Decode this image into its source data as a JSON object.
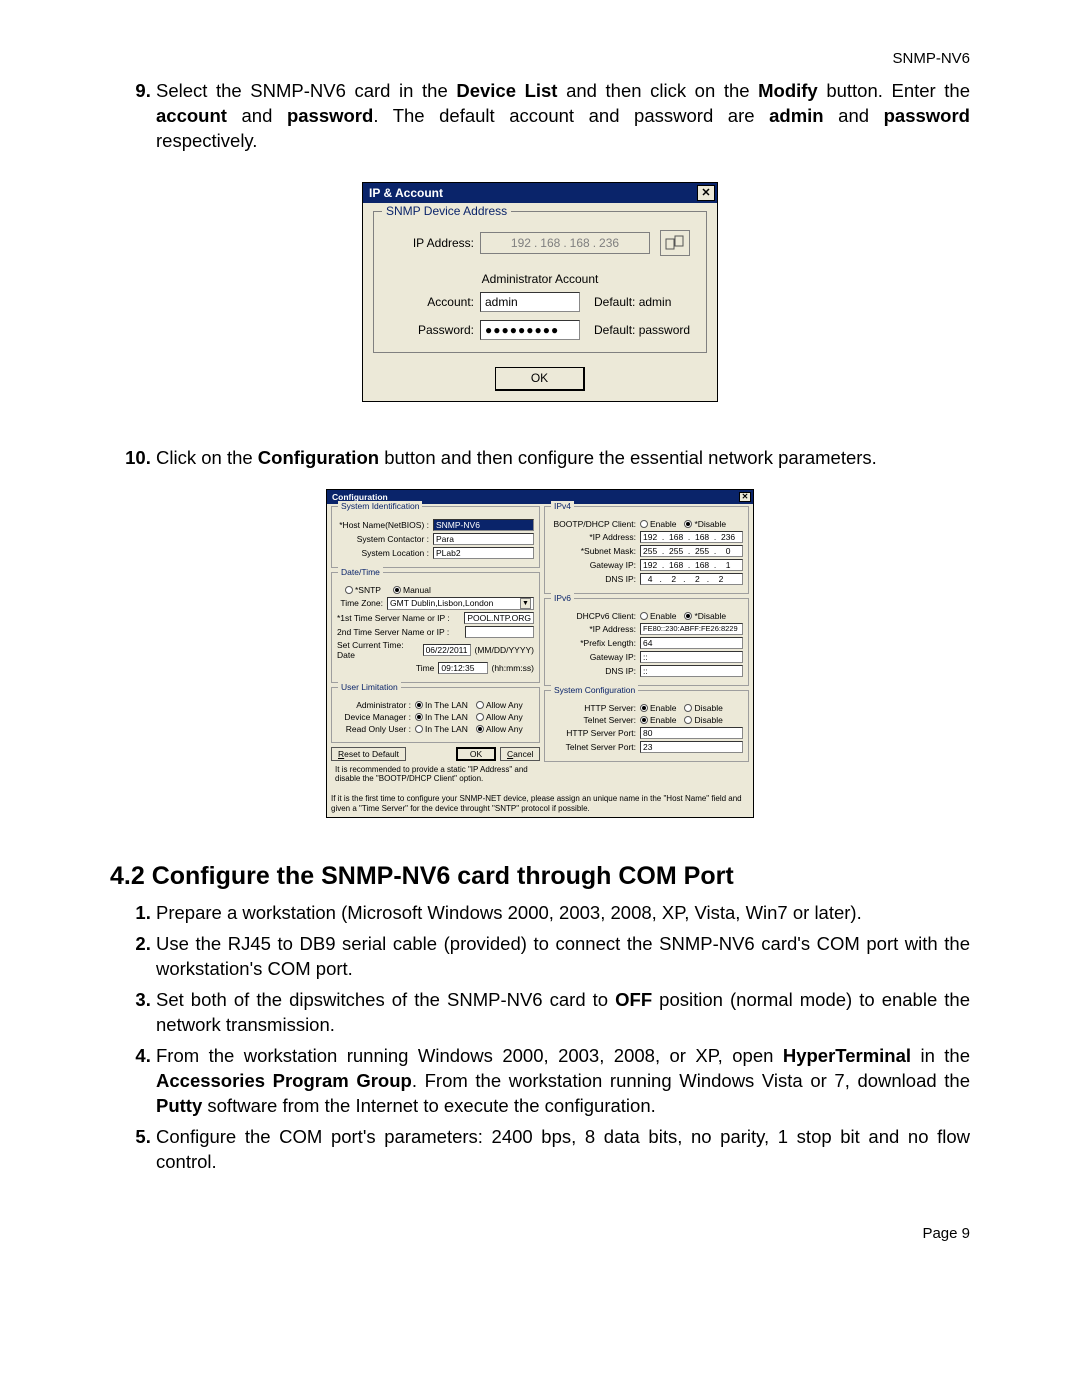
{
  "header": "SNMP-NV6",
  "footer": "Page 9",
  "step9": {
    "num": "9.",
    "text_before": "Select the SNMP-NV6 card in the ",
    "b1": "Device List",
    "t2": " and then click on the ",
    "b2": "Modify",
    "t3": " button. Enter the ",
    "b3": "account",
    "t4": " and ",
    "b4": "password",
    "t5": ". The default account and password are ",
    "b5": "admin",
    "t6": " and ",
    "b6": "password",
    "t7": " respectively."
  },
  "dlg1": {
    "title": "IP & Account",
    "legend": "SNMP Device Address",
    "ip_label": "IP Address:",
    "ip": {
      "a": "192",
      "b": "168",
      "c": "168",
      "d": "236"
    },
    "admin_header": "Administrator Account",
    "account_label": "Account:",
    "account_value": "admin",
    "account_default": "Default: admin",
    "password_label": "Password:",
    "password_value": "●●●●●●●●●",
    "password_default": "Default: password",
    "ok": "OK"
  },
  "step10": {
    "t1": "Click on the ",
    "b1": "Configuration",
    "t2": " button and then configure the essential network parameters."
  },
  "dlg2": {
    "title": "Configuration",
    "sysid": {
      "legend": "System Identification",
      "host_lbl": "*Host Name(NetBIOS) :",
      "host_val": "SNMP-NV6",
      "contactor_lbl": "System Contactor :",
      "contactor_val": "Para",
      "location_lbl": "System Location :",
      "location_val": "PLab2"
    },
    "dt": {
      "legend": "Date/Time",
      "sntp": "*SNTP",
      "manual": "Manual",
      "tz_lbl": "Time Zone:",
      "tz_val": "GMT Dublin,Lisbon,London",
      "ts1_lbl": "*1st Time Server Name or IP :",
      "ts1_val": "POOL.NTP.ORG",
      "ts2_lbl": "2nd Time Server Name or IP :",
      "ts2_val": "",
      "date_lbl": "Set Current Time:   Date",
      "date_val": "06/22/2011",
      "date_hint": "(MM/DD/YYYY)",
      "time_lbl": "Time",
      "time_val": "09:12:35",
      "time_hint": "(hh:mm:ss)"
    },
    "ul": {
      "legend": "User Limitation",
      "admin_lbl": "Administrator :",
      "dm_lbl": "Device Manager :",
      "ro_lbl": "Read Only User :",
      "inlan": "In The LAN",
      "allow": "Allow Any"
    },
    "ipv4": {
      "legend": "IPv4",
      "bootp_lbl": "BOOTP/DHCP Client:",
      "enable": "Enable",
      "disable": "*Disable",
      "ip_lbl": "*IP Address:",
      "ip": "192  .  168  .  168  .  236",
      "mask_lbl": "*Subnet Mask:",
      "mask": "255  .  255  .  255  .    0",
      "gw_lbl": "Gateway IP:",
      "gw": "192  .  168  .  168  .    1",
      "dns_lbl": "DNS IP:",
      "dns": "  4   .    2   .    2   .    2"
    },
    "ipv6": {
      "legend": "IPv6",
      "dhcpv6_lbl": "DHCPv6 Client:",
      "enable": "Enable",
      "disable": "*Disable",
      "ip_lbl": "*IP Address:",
      "ip": "FE80::230:ABFF:FE26:8229",
      "pl_lbl": "*Prefix Length:",
      "pl": "64",
      "gw_lbl": "Gateway IP:",
      "gw": "::",
      "dns_lbl": "DNS IP:",
      "dns": "::"
    },
    "syscfg": {
      "legend": "System Configuration",
      "http_lbl": "HTTP Server:",
      "telnet_lbl": "Telnet Server:",
      "enable": "Enable",
      "disable": "Disable",
      "httpport_lbl": "HTTP Server Port:",
      "httpport": "80",
      "telnetport_lbl": "Telnet Server Port:",
      "telnetport": "23"
    },
    "reset": "Reset to Default",
    "ok": "OK",
    "cancel": "Cancel",
    "note1": "It is recommended to provide a static \"IP Address\" and disable the \"BOOTP/DHCP Client\" option.",
    "note2": "If it is the first time to configure your SNMP-NET device, please assign an unique name in the \"Host Name\" field and given a \"Time Server\" for the device throught \"SNTP\" protocol if possible."
  },
  "section": "4.2 Configure the SNMP-NV6 card through COM Port",
  "steps2": {
    "s1": "Prepare a workstation (Microsoft Windows 2000, 2003, 2008, XP, Vista, Win7 or later).",
    "s2": "Use the RJ45 to DB9 serial cable (provided) to connect the SNMP-NV6 card's COM port with the workstation's COM port.",
    "s3a": "Set both of the dipswitches of the SNMP-NV6 card to ",
    "s3b": "OFF",
    "s3c": " position (normal mode) to enable the network transmission.",
    "s4a": "From the workstation running Windows 2000, 2003, 2008, or XP, open ",
    "s4b": "HyperTerminal",
    "s4c": " in the ",
    "s4d": "Accessories Program Group",
    "s4e": ". From the workstation running Windows Vista or 7, download the ",
    "s4f": "Putty",
    "s4g": " software from the Internet to execute the configuration.",
    "s5": "Configure the COM port's parameters:  2400 bps, 8 data bits, no parity, 1 stop bit and no flow control."
  }
}
